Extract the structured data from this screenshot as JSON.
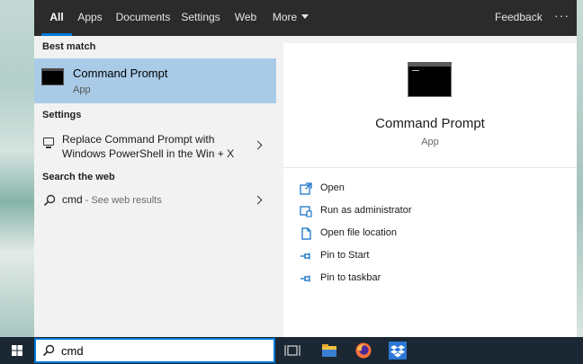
{
  "tabs": [
    {
      "label": "All",
      "active": true
    },
    {
      "label": "Apps"
    },
    {
      "label": "Documents"
    },
    {
      "label": "Settings"
    },
    {
      "label": "Web"
    },
    {
      "label": "More"
    }
  ],
  "topbar": {
    "feedback_label": "Feedback",
    "more_options": "···"
  },
  "results": {
    "best_match_heading": "Best match",
    "best_match": {
      "title": "Command Prompt",
      "subtitle": "App",
      "icon": "command-prompt-icon"
    },
    "settings_heading": "Settings",
    "setting_item": {
      "text": "Replace Command Prompt with Windows PowerShell in the Win + X",
      "icon": "monitor-icon"
    },
    "web_heading": "Search the web",
    "web_item": {
      "query": "cmd",
      "hint": " - See web results",
      "icon": "search-icon"
    }
  },
  "detail": {
    "title": "Command Prompt",
    "subtitle": "App",
    "actions": [
      {
        "label": "Open",
        "icon": "open-icon"
      },
      {
        "label": "Run as administrator",
        "icon": "shield-icon"
      },
      {
        "label": "Open file location",
        "icon": "file-location-icon"
      },
      {
        "label": "Pin to Start",
        "icon": "pin-icon"
      },
      {
        "label": "Pin to taskbar",
        "icon": "pin-icon"
      }
    ]
  },
  "taskbar": {
    "search_value": "cmd",
    "icons": [
      "windows-start-icon",
      "task-view-icon",
      "file-explorer-icon",
      "firefox-icon",
      "dropbox-icon"
    ]
  },
  "colors": {
    "accent": "#0078d7",
    "selection": "#a9cbe8",
    "topbar": "#2b2b2b",
    "taskbar": "#1b2733"
  }
}
